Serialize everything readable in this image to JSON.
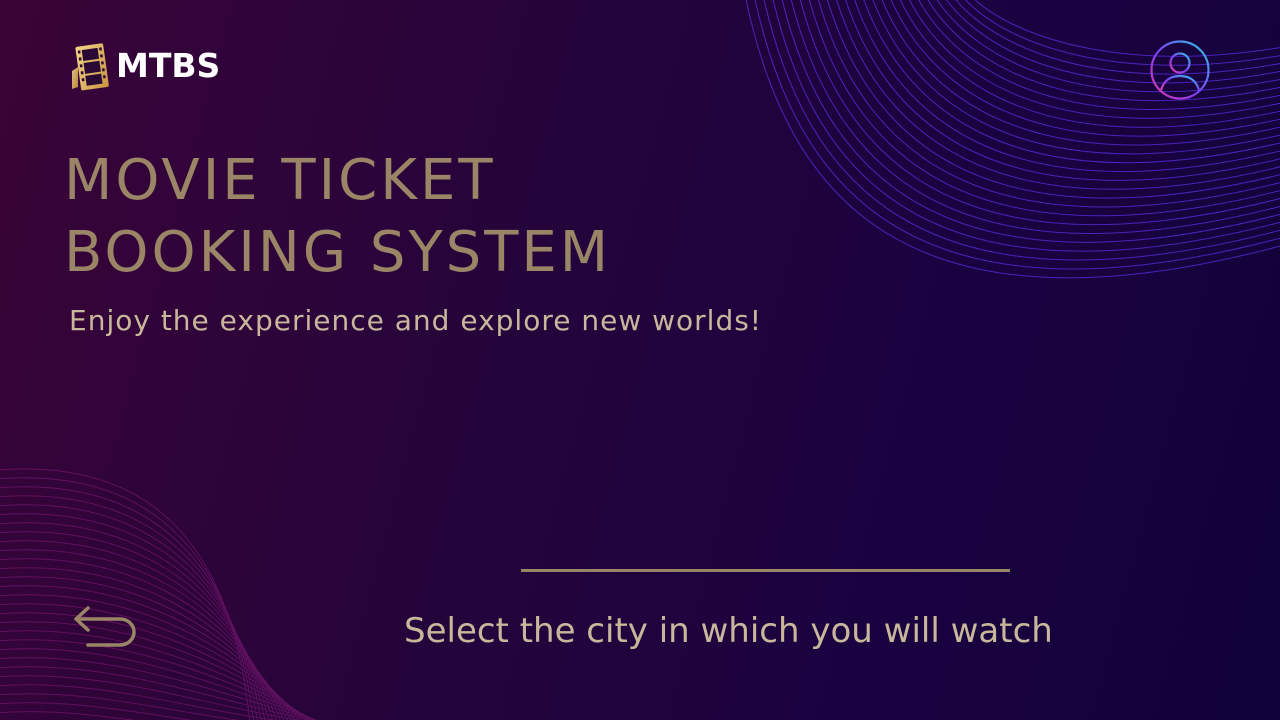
{
  "brand": {
    "logo_icon": "film-strip-icon",
    "name": "MTBS",
    "accent_color": "#e2bb63"
  },
  "header": {
    "profile_icon": "user-avatar-icon",
    "ring_colors": [
      "#2ec6e6",
      "#7b3ff2",
      "#e13aa8"
    ]
  },
  "hero": {
    "title_line1": "MOVIE TICKET",
    "title_line2": "BOOKING SYSTEM",
    "subtitle": "Enjoy the experience and explore new worlds!",
    "title_color": "#9a8566"
  },
  "footer": {
    "back_icon": "undo-arrow-icon",
    "prompt": "Select the city in which you will watch"
  }
}
